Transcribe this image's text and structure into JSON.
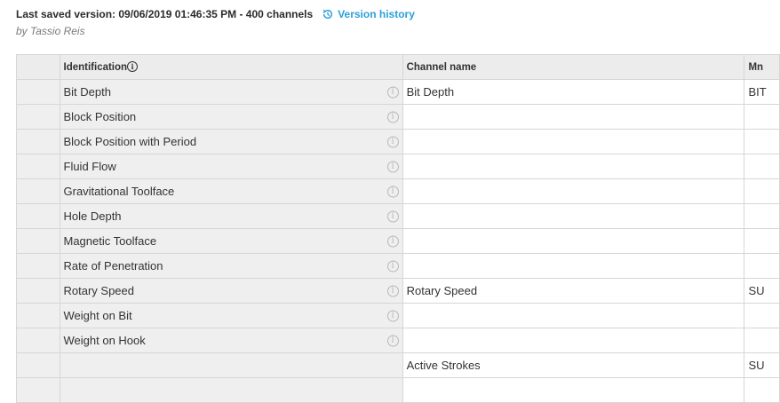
{
  "header": {
    "saved_text": "Last saved version: 09/06/2019 01:46:35 PM - 400 channels",
    "version_link": "Version history",
    "byline": "by Tassio Reis"
  },
  "table": {
    "columns": {
      "identification": "Identification",
      "identification_info": "i",
      "channel": "Channel name",
      "mnemonic": "Mn"
    },
    "rows": [
      {
        "identification": "Bit Depth",
        "channel": "Bit Depth",
        "mnemonic": "BIT"
      },
      {
        "identification": "Block Position",
        "channel": "",
        "mnemonic": ""
      },
      {
        "identification": "Block Position with Period",
        "channel": "",
        "mnemonic": ""
      },
      {
        "identification": "Fluid Flow",
        "channel": "",
        "mnemonic": ""
      },
      {
        "identification": "Gravitational Toolface",
        "channel": "",
        "mnemonic": ""
      },
      {
        "identification": "Hole Depth",
        "channel": "",
        "mnemonic": ""
      },
      {
        "identification": "Magnetic Toolface",
        "channel": "",
        "mnemonic": ""
      },
      {
        "identification": "Rate of Penetration",
        "channel": "",
        "mnemonic": ""
      },
      {
        "identification": "Rotary Speed",
        "channel": "Rotary Speed",
        "mnemonic": "SU"
      },
      {
        "identification": "Weight on Bit",
        "channel": "",
        "mnemonic": ""
      },
      {
        "identification": "Weight on Hook",
        "channel": "",
        "mnemonic": ""
      },
      {
        "identification": "",
        "channel": "Active Strokes",
        "mnemonic": "SU"
      },
      {
        "identification": "",
        "channel": "",
        "mnemonic": ""
      }
    ]
  },
  "icons": {
    "version": "history-icon",
    "row_info": "info-icon"
  },
  "colors": {
    "link": "#2b9fd8",
    "header_bg": "#ececec",
    "border": "#d6d6d6"
  }
}
